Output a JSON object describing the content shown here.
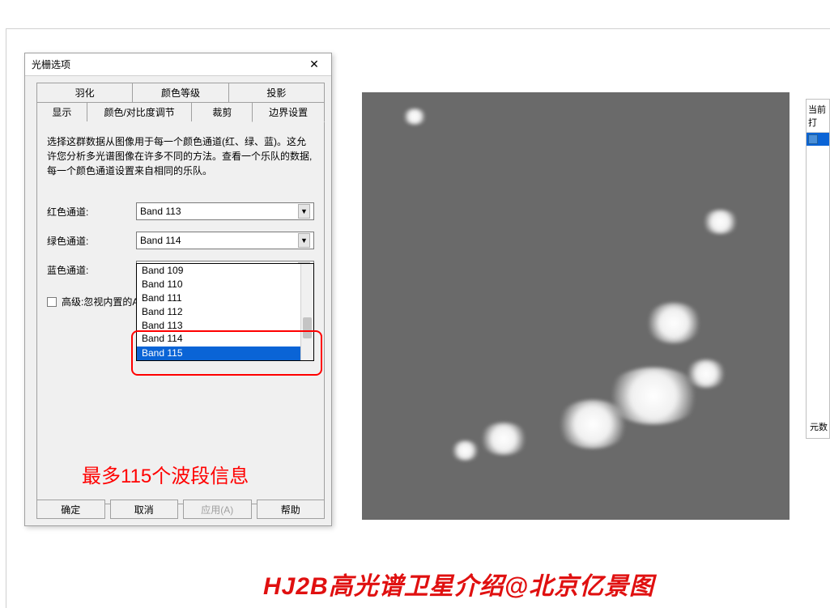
{
  "dialog": {
    "title": "光栅选项",
    "close_icon": "✕",
    "tabs_row1": [
      "羽化",
      "颜色等级",
      "投影"
    ],
    "tabs_row2": [
      "显示",
      "颜色/对比度调节",
      "裁剪",
      "边界设置"
    ],
    "description": "选择这群数据从图像用于每一个颜色通道(红、绿、蓝)。这允许您分析多光谱图像在许多不同的方法。查看一个乐队的数据,每一个颜色通道设置来自相同的乐队。",
    "channels": {
      "red_label": "红色通道:",
      "red_value": "Band 113",
      "green_label": "绿色通道:",
      "green_value": "Band 114",
      "blue_label": "蓝色通道:",
      "blue_value": "Band 115"
    },
    "dropdown_items": [
      "Band 109",
      "Band 110",
      "Band 111",
      "Band 112",
      "Band 113",
      "Band 114",
      "Band 115"
    ],
    "dropdown_selected": "Band 115",
    "checkbox_label": "高级:忽视内置的Alpha",
    "buttons": {
      "ok": "确定",
      "cancel": "取消",
      "apply": "应用(A)",
      "help": "帮助"
    }
  },
  "annotation": {
    "red_text": "最多115个波段信息"
  },
  "side_panel": {
    "header": "当前打",
    "footer": "元数"
  },
  "watermark": "HJ2B高光谱卫星介绍@北京亿景图"
}
